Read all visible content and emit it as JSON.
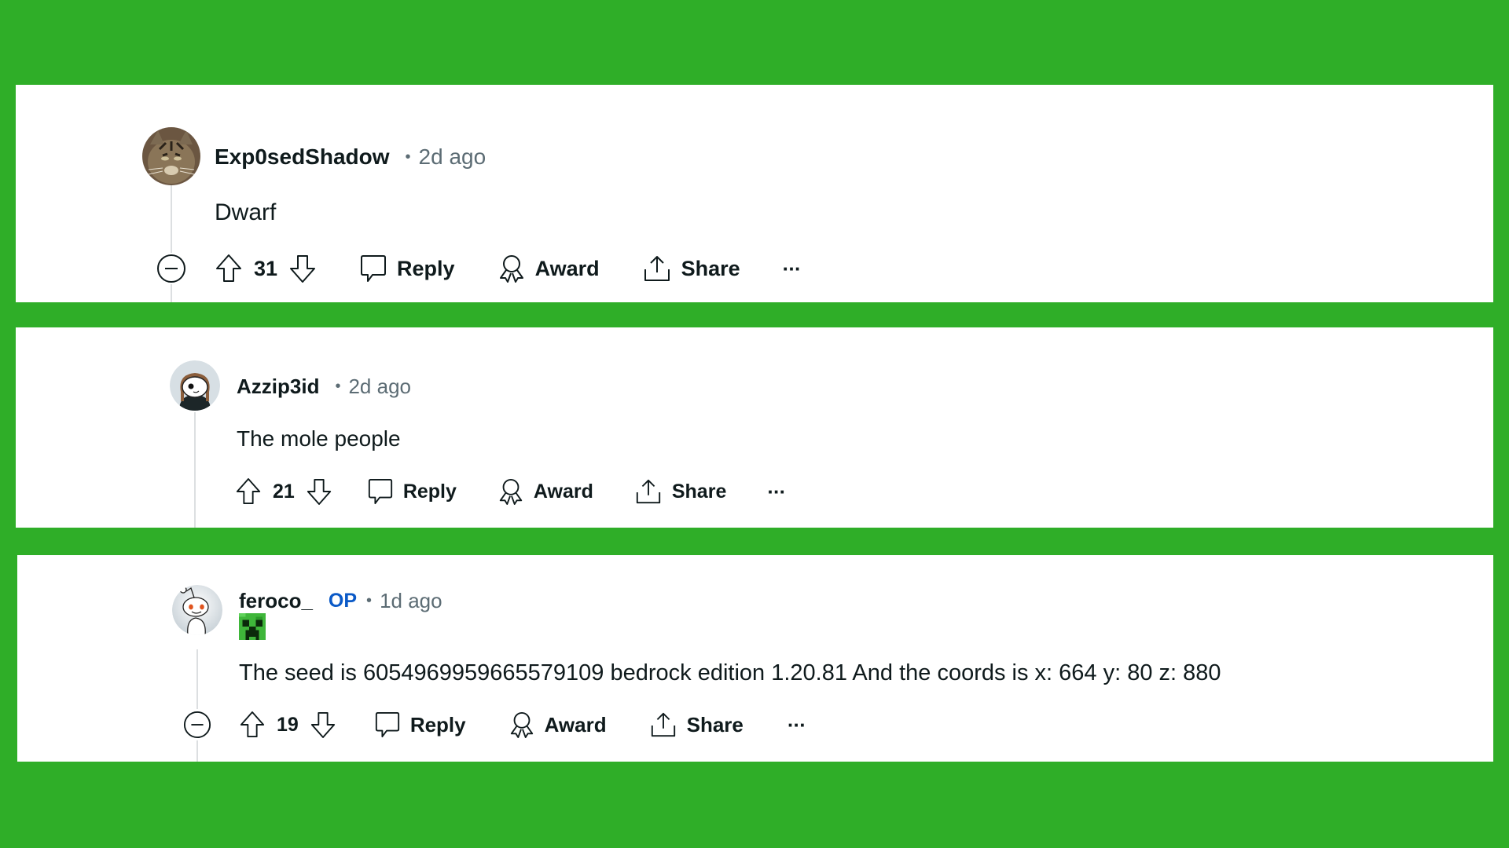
{
  "comments": [
    {
      "username": "Exp0sedShadow",
      "is_op": false,
      "timestamp": "2d ago",
      "text": "Dwarf",
      "score": "31",
      "avatar_icon": "cat-photo-avatar",
      "actions": {
        "reply": "Reply",
        "award": "Award",
        "share": "Share",
        "more": "···"
      },
      "collapsible": true
    },
    {
      "username": "Azzip3id",
      "is_op": false,
      "timestamp": "2d ago",
      "text": "The mole people",
      "score": "21",
      "avatar_icon": "snoo-avatar-brown-hair",
      "actions": {
        "reply": "Reply",
        "award": "Award",
        "share": "Share",
        "more": "···"
      },
      "collapsible": false
    },
    {
      "username": "feroco_",
      "is_op": true,
      "op_label": "OP",
      "timestamp": "1d ago",
      "flair_icon": "creeper-face-icon",
      "text": "The seed is 6054969959665579109 bedrock edition 1.20.81 And the coords is x: 664 y: 80 z: 880",
      "score": "19",
      "avatar_icon": "snoo-avatar-default",
      "actions": {
        "reply": "Reply",
        "award": "Award",
        "share": "Share",
        "more": "···"
      },
      "collapsible": true
    }
  ],
  "separator": "•",
  "colors": {
    "background": "#2fae28",
    "panel": "#ffffff",
    "username": "#0f1a1c",
    "meta": "#5c6c74",
    "op": "#0a59c7"
  }
}
